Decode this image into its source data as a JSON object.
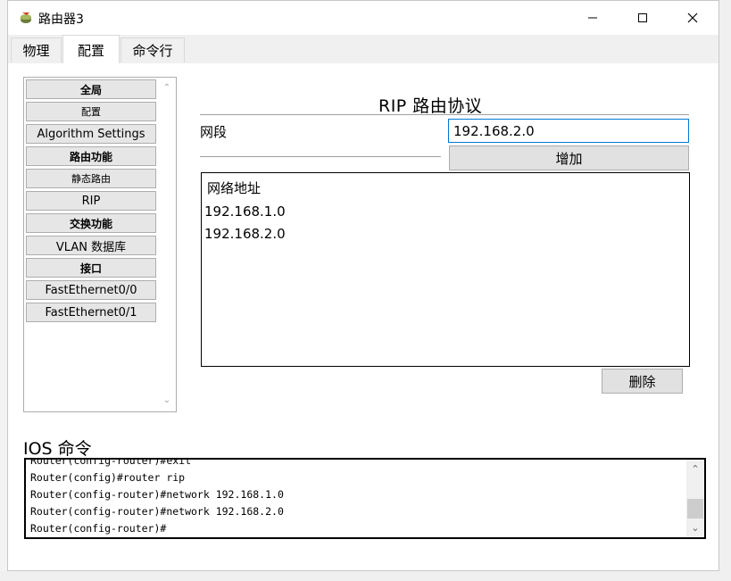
{
  "window": {
    "title": "路由器3"
  },
  "tabs": [
    {
      "label": "物理"
    },
    {
      "label": "配置"
    },
    {
      "label": "命令行"
    }
  ],
  "nav": {
    "items": [
      {
        "label": "全局",
        "kind": "header"
      },
      {
        "label": "配置",
        "kind": "small"
      },
      {
        "label": "Algorithm Settings",
        "kind": "item"
      },
      {
        "label": "路由功能",
        "kind": "header"
      },
      {
        "label": "静态路由",
        "kind": "small"
      },
      {
        "label": "RIP",
        "kind": "item"
      },
      {
        "label": "交换功能",
        "kind": "header"
      },
      {
        "label": "VLAN 数据库",
        "kind": "item"
      },
      {
        "label": "接口",
        "kind": "header"
      },
      {
        "label": "FastEthernet0/0",
        "kind": "item"
      },
      {
        "label": "FastEthernet0/1",
        "kind": "item"
      }
    ]
  },
  "rip": {
    "title": "RIP 路由协议",
    "network_label": "网段",
    "network_value": "192.168.2.0",
    "add_label": "增加",
    "list_header": "网络地址",
    "networks": [
      "192.168.1.0",
      "192.168.2.0"
    ],
    "delete_label": "删除"
  },
  "ios": {
    "label": "IOS 命令",
    "lines": [
      "Router(config-router)#exit",
      "Router(config)#router rip",
      "Router(config-router)#network 192.168.1.0",
      "Router(config-router)#network 192.168.2.0",
      "Router(config-router)#"
    ]
  },
  "icons": {
    "app": "router-app-icon",
    "minimize": "minimize-icon",
    "maximize": "maximize-icon",
    "close": "close-icon"
  }
}
